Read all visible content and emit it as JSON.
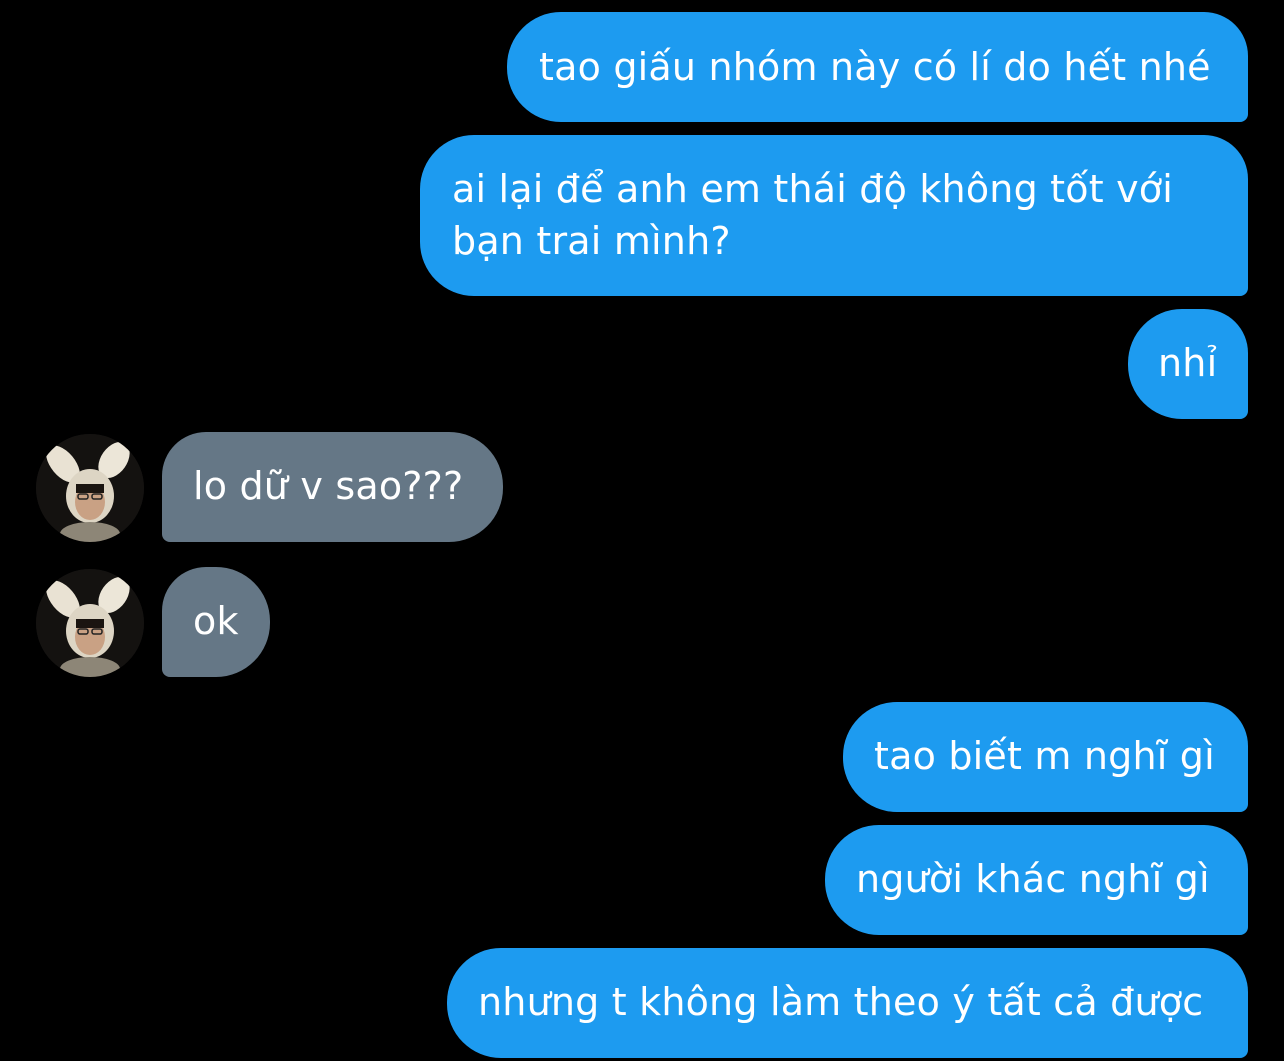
{
  "conversation": {
    "messages": [
      {
        "from": "me",
        "text": "tao giấu nhóm này có lí do hết nhé"
      },
      {
        "from": "me",
        "text_line1": "ai lại để anh em thái độ không tốt với",
        "text_line2": "bạn trai mình?"
      },
      {
        "from": "me",
        "text": "nhỉ"
      },
      {
        "from": "them",
        "text": "lo dữ v sao???"
      },
      {
        "from": "them",
        "text": "ok"
      },
      {
        "from": "me",
        "text": "tao biết m nghĩ gì"
      },
      {
        "from": "me",
        "text": "người khác nghĩ gì"
      },
      {
        "from": "me",
        "text": "nhưng t không làm theo ý tất cả được"
      }
    ]
  },
  "colors": {
    "background": "#000000",
    "outgoing_bubble": "#1d9bf0",
    "incoming_bubble": "#657786",
    "text": "#ffffff"
  },
  "icons": {
    "avatar": "bunny-ears-person-avatar"
  }
}
